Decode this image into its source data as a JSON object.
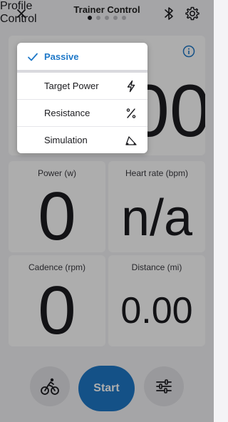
{
  "header": {
    "title": "Trainer Control",
    "page_count": 5,
    "active_page": 1
  },
  "mode_menu": {
    "items": [
      {
        "label": "Passive",
        "selected": true,
        "icon": "checkmark-icon"
      },
      {
        "label": "Target Power",
        "selected": false,
        "icon": "lightning-icon"
      },
      {
        "label": "Resistance",
        "selected": false,
        "icon": "percent-icon"
      },
      {
        "label": "Simulation",
        "selected": false,
        "icon": "slope-icon"
      }
    ]
  },
  "control_panel": {
    "value_fragment": "00"
  },
  "metrics": [
    {
      "label": "Power (w)",
      "value": "0"
    },
    {
      "label": "Heart rate (bpm)",
      "value": "n/a"
    },
    {
      "label": "Cadence (rpm)",
      "value": "0"
    },
    {
      "label": "Distance (mi)",
      "value": "0.00"
    }
  ],
  "bottom_bar": {
    "profile_label": "Profile",
    "start_label": "Start",
    "control_label": "Control"
  },
  "colors": {
    "accent": "#1e78c8",
    "overlay": "rgba(0,0,0,0.32)"
  }
}
